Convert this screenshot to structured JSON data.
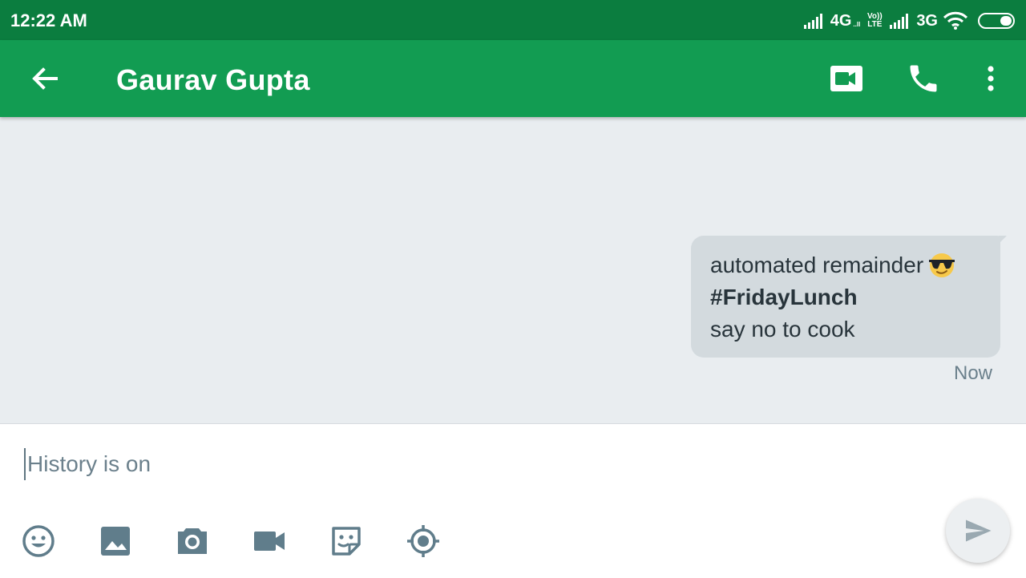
{
  "status_bar": {
    "time": "12:22 AM",
    "network_1": "4G",
    "network_1_sub": "..ll",
    "volte_top": "Vo))",
    "volte_bottom": "LTE",
    "network_2": "3G",
    "icons": [
      "signal-icon",
      "signal-icon",
      "wifi-icon",
      "battery-icon"
    ]
  },
  "header": {
    "contact_name": "Gaurav Gupta",
    "icons": [
      "back-arrow-icon",
      "video-call-icon",
      "phone-icon",
      "more-vert-icon"
    ],
    "color": "#129c52"
  },
  "messages": [
    {
      "lines": [
        "automated remainder",
        "#FridayLunch",
        "say no to cook"
      ],
      "emoji": "smiling-face-with-sunglasses",
      "time": "Now",
      "direction": "outgoing"
    }
  ],
  "composer": {
    "placeholder": "History is on",
    "value": "",
    "tools": [
      "emoji-icon",
      "image-icon",
      "camera-icon",
      "video-icon",
      "sticker-icon",
      "location-icon",
      "send-icon"
    ]
  },
  "colors": {
    "status_bar": "#0b7d3f",
    "app_bar": "#129c52",
    "background": "#e9edf0",
    "bubble": "#d3dade",
    "icon_gray": "#607d8b"
  }
}
